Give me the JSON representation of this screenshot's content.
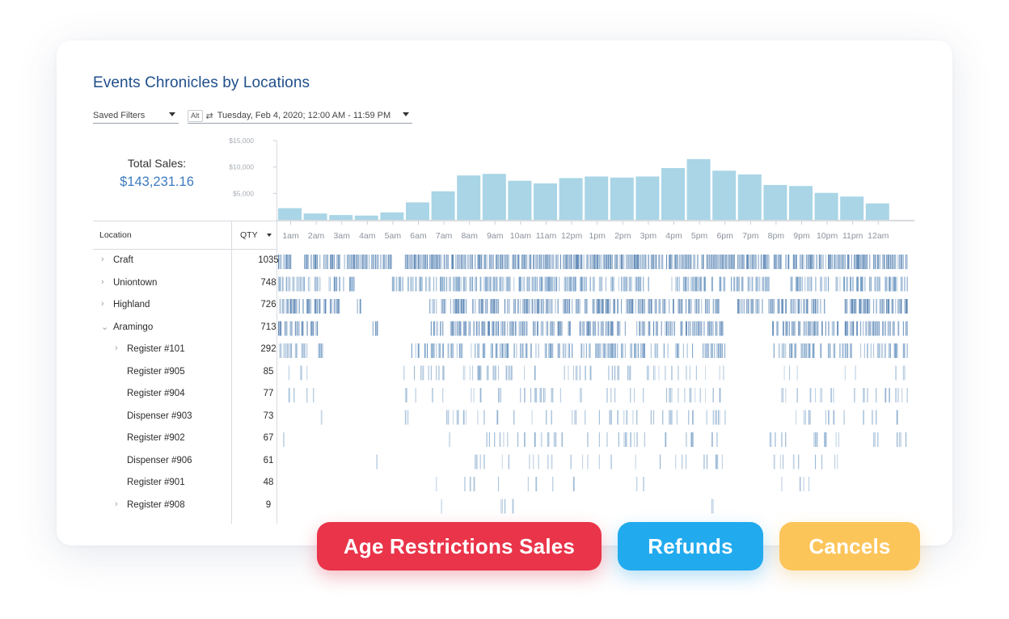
{
  "title": "Events Chronicles by Locations",
  "filters": {
    "saved_filters": "Saved Filters",
    "alt_label": "Alt",
    "swap_icon": "swap-icon",
    "date_range": "Tuesday, Feb 4, 2020; 12:00 AM - 11:59 PM"
  },
  "total": {
    "label": "Total Sales:",
    "value": "$143,231.16"
  },
  "table": {
    "col_location": "Location",
    "col_qty": "QTY"
  },
  "chart_data": {
    "type": "bar",
    "categories": [
      "1am",
      "2am",
      "3am",
      "4am",
      "5am",
      "6am",
      "7am",
      "8am",
      "9am",
      "10am",
      "11am",
      "12pm",
      "1pm",
      "2pm",
      "3pm",
      "4pm",
      "5pm",
      "6pm",
      "7pm",
      "8pm",
      "9pm",
      "10pm",
      "11pm",
      "12am"
    ],
    "values": [
      2200,
      1200,
      900,
      800,
      1400,
      3300,
      5400,
      8400,
      8700,
      7400,
      6900,
      7900,
      8200,
      8000,
      8200,
      9800,
      11500,
      9300,
      8600,
      6600,
      6400,
      5100,
      4400,
      3100
    ],
    "yticks": [
      5000,
      10000,
      15000
    ],
    "ytick_labels": [
      "$5,000",
      "$10,000",
      "$15,000"
    ],
    "ylim": [
      0,
      15000
    ],
    "color": "#a9d5e6"
  },
  "rows": [
    {
      "name": "Craft",
      "qty": "1035",
      "level": 0,
      "expand": "right",
      "color": "#5b86b5",
      "density": 0.82,
      "gaps": [
        [
          0.02,
          0.04
        ],
        [
          0.18,
          0.2
        ]
      ],
      "seed": 3
    },
    {
      "name": "Uniontown",
      "qty": "748",
      "level": 0,
      "expand": "right",
      "color": "#6e98c2",
      "density": 0.62,
      "gaps": [
        [
          0.12,
          0.18
        ],
        [
          0.59,
          0.62
        ],
        [
          0.78,
          0.81
        ]
      ],
      "seed": 7
    },
    {
      "name": "Highland",
      "qty": "726",
      "level": 0,
      "expand": "right",
      "color": "#5b86b5",
      "density": 0.6,
      "gaps": [
        [
          0.1,
          0.12
        ],
        [
          0.13,
          0.24
        ],
        [
          0.7,
          0.72
        ],
        [
          0.87,
          0.9
        ]
      ],
      "seed": 11
    },
    {
      "name": "Aramingo",
      "qty": "713",
      "level": 0,
      "expand": "down",
      "color": "#5b86b5",
      "density": 0.6,
      "gaps": [
        [
          0.07,
          0.15
        ],
        [
          0.16,
          0.24
        ],
        [
          0.71,
          0.78
        ]
      ],
      "seed": 13
    },
    {
      "name": "Register #101",
      "qty": "292",
      "level": 1,
      "expand": "right",
      "color": "#6e98c2",
      "density": 0.45,
      "gaps": [
        [
          0.07,
          0.21
        ],
        [
          0.71,
          0.78
        ]
      ],
      "seed": 17
    },
    {
      "name": "Register #905",
      "qty": "85",
      "level": 2,
      "expand": "none",
      "color": "#8fb0d0",
      "density": 0.2,
      "gaps": [
        [
          0.06,
          0.19
        ],
        [
          0.71,
          0.78
        ],
        [
          0.83,
          0.9
        ],
        [
          0.93,
          0.98
        ]
      ],
      "seed": 19
    },
    {
      "name": "Register #904",
      "qty": "77",
      "level": 2,
      "expand": "none",
      "color": "#8fb0d0",
      "density": 0.18,
      "gaps": [
        [
          0.06,
          0.2
        ],
        [
          0.71,
          0.78
        ]
      ],
      "seed": 23
    },
    {
      "name": "Dispenser #903",
      "qty": "73",
      "level": 2,
      "expand": "none",
      "color": "#8fb0d0",
      "density": 0.16,
      "gaps": [
        [
          0.01,
          0.06
        ],
        [
          0.08,
          0.2
        ],
        [
          0.21,
          0.26
        ],
        [
          0.71,
          0.78
        ]
      ],
      "seed": 29
    },
    {
      "name": "Register #902",
      "qty": "67",
      "level": 2,
      "expand": "none",
      "color": "#8fb0d0",
      "density": 0.14,
      "gaps": [
        [
          0.03,
          0.26
        ],
        [
          0.71,
          0.78
        ]
      ],
      "seed": 31
    },
    {
      "name": "Dispenser #906",
      "qty": "61",
      "level": 2,
      "expand": "none",
      "color": "#8fb0d0",
      "density": 0.13,
      "gaps": [
        [
          0.04,
          0.15
        ],
        [
          0.16,
          0.3
        ],
        [
          0.71,
          0.78
        ],
        [
          0.91,
          1.0
        ]
      ],
      "seed": 37
    },
    {
      "name": "Register #901",
      "qty": "48",
      "level": 2,
      "expand": "none",
      "color": "#8fb0d0",
      "density": 0.11,
      "gaps": [
        [
          0.0,
          0.24
        ],
        [
          0.71,
          0.78
        ],
        [
          0.88,
          0.94
        ],
        [
          0.95,
          1.0
        ]
      ],
      "seed": 41
    },
    {
      "name": "Register #908",
      "qty": "9",
      "level": 1,
      "expand": "right",
      "color": "#8fb0d0",
      "density": 0.05,
      "gaps": [
        [
          0.0,
          0.21
        ],
        [
          0.4,
          0.65
        ],
        [
          0.71,
          1.0
        ]
      ],
      "seed": 43
    }
  ],
  "badges": {
    "age_restrictions": "Age Restrictions Sales",
    "refunds": "Refunds",
    "cancels": "Cancels"
  },
  "colors": {
    "title": "#1f4f8b",
    "total_value": "#3d7bbf",
    "age_restrictions": "#e9344a",
    "refunds": "#22aaee",
    "cancels": "#fcc55a"
  }
}
